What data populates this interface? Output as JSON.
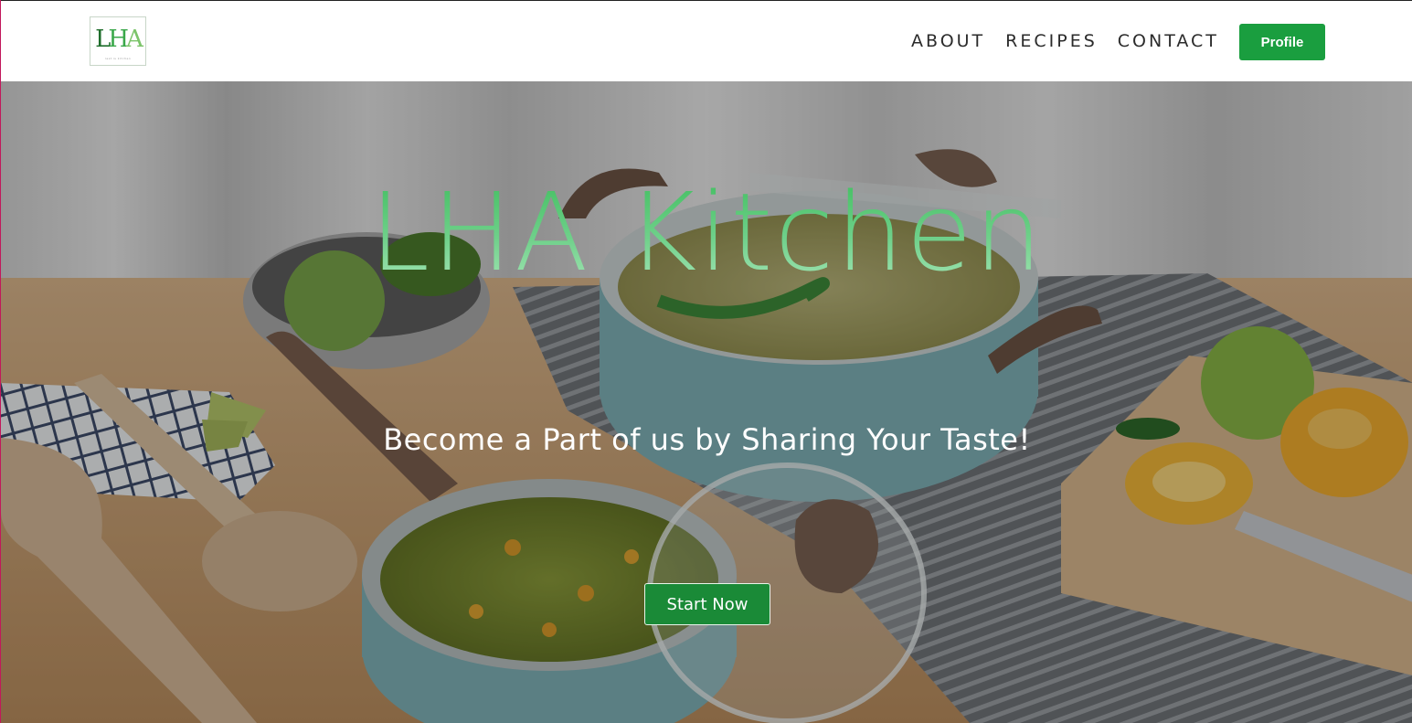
{
  "brand": {
    "logo_text": "LHA",
    "logo_tagline": "rest is kitchen",
    "accent_color": "#1a9e3f"
  },
  "nav": {
    "links": [
      "ABOUT",
      "RECIPES",
      "CONTACT"
    ],
    "profile_label": "Profile"
  },
  "hero": {
    "title": "LHA Kitchen",
    "subtitle": "Become a Part of us by Sharing Your Taste!",
    "cta_label": "Start Now",
    "background": "kitchen scene with blue pots, wooden utensils and peppers"
  },
  "icons": {
    "logo": "lha-logo-icon"
  }
}
